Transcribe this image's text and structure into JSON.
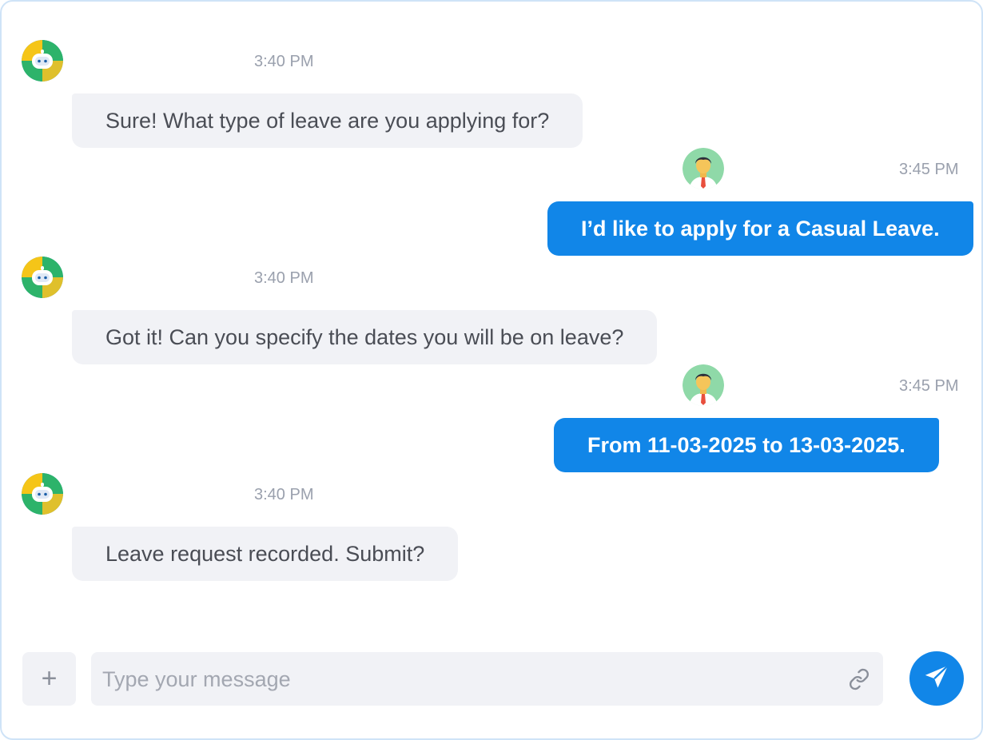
{
  "messages": [
    {
      "sender": "bot",
      "time": "3:40 PM",
      "text": "Sure! What type of leave are you applying for?"
    },
    {
      "sender": "user",
      "time": "3:45 PM",
      "text": "I’d like to apply for a Casual Leave."
    },
    {
      "sender": "bot",
      "time": "3:40 PM",
      "text": "Got it! Can you specify the dates you will be on leave?"
    },
    {
      "sender": "user",
      "time": "3:45 PM",
      "text": "From 11-03-2025 to 13-03-2025."
    },
    {
      "sender": "bot",
      "time": "3:40 PM",
      "text": "Leave request recorded. Submit?"
    }
  ],
  "composer": {
    "add_label": "+",
    "placeholder": "Type your message",
    "value": "",
    "attach_icon": "link-icon",
    "send_icon": "paper-plane-icon"
  },
  "colors": {
    "accent": "#1186e8",
    "bot_bubble": "#f1f2f6",
    "timestamp": "#9aa0ad"
  }
}
